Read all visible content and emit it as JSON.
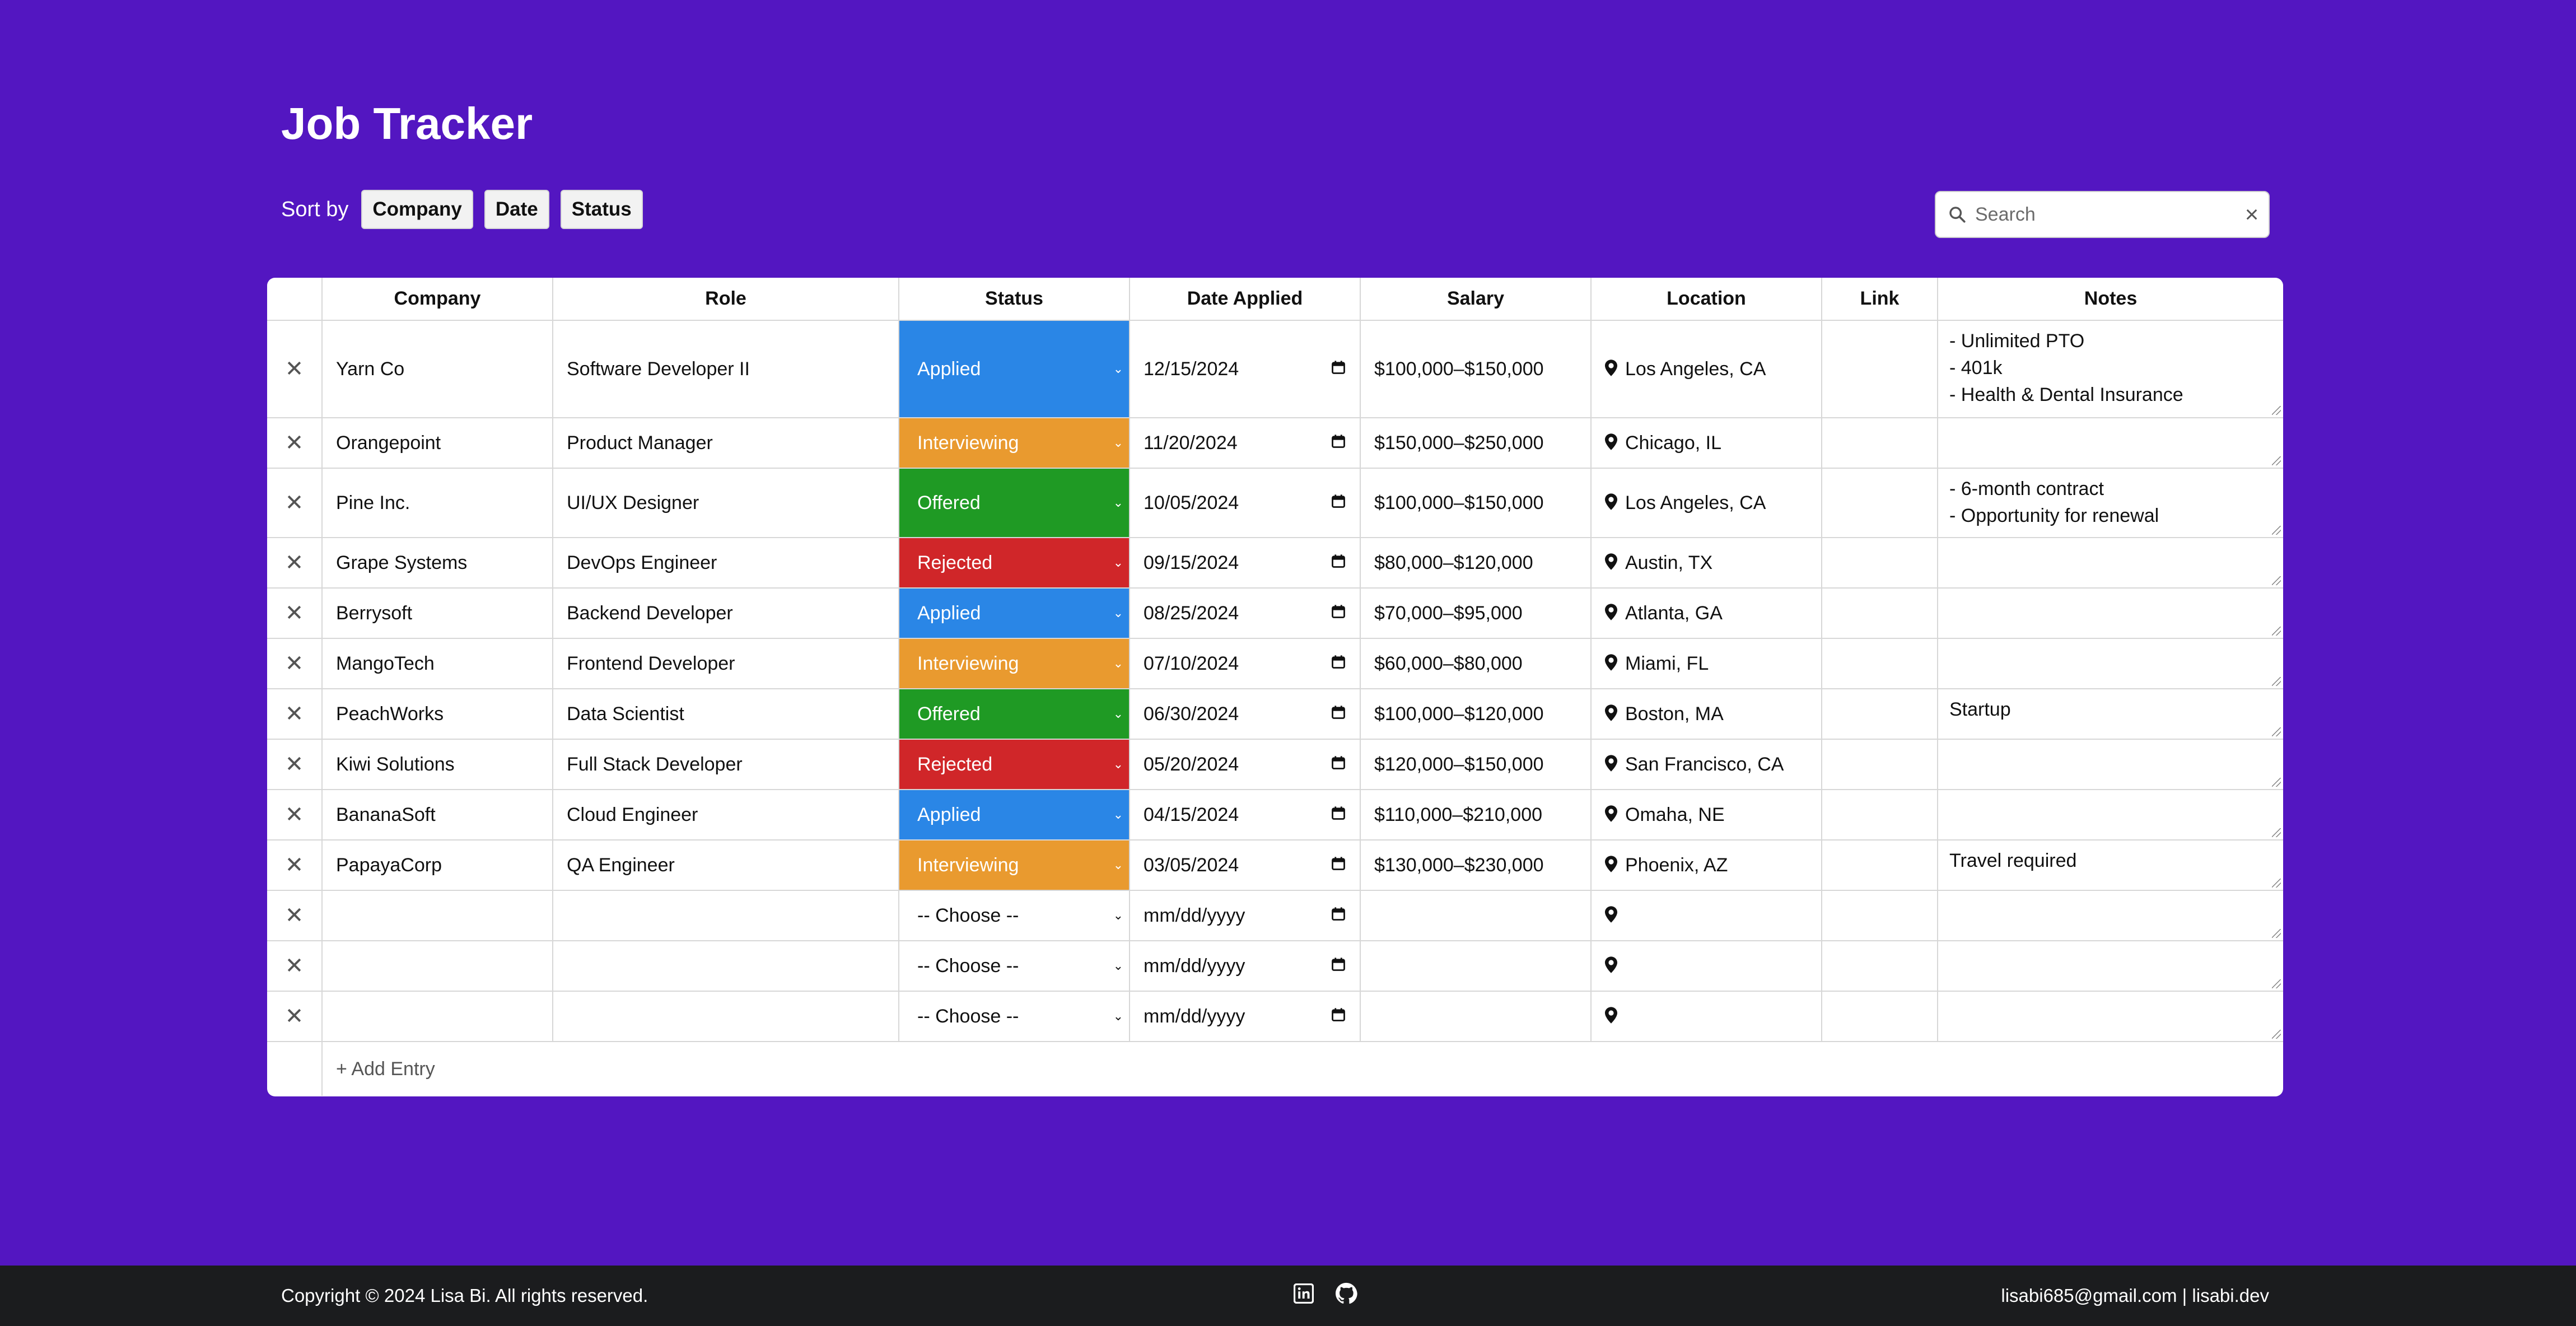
{
  "app": {
    "title": "Job Tracker"
  },
  "sort": {
    "label": "Sort by",
    "buttons": [
      "Company",
      "Date",
      "Status"
    ]
  },
  "search": {
    "placeholder": "Search",
    "value": ""
  },
  "colors": {
    "background": "#5316c1",
    "Applied": "#2a86e6",
    "Interviewing": "#e99a2f",
    "Offered": "#1f9a24",
    "Rejected": "#d02629"
  },
  "table": {
    "headers": [
      "",
      "Company",
      "Role",
      "Status",
      "Date Applied",
      "Salary",
      "Location",
      "Link",
      "Notes"
    ],
    "rows": [
      {
        "company": "Yarn Co",
        "role": "Software Developer II",
        "status": "Applied",
        "date": "12/15/2024",
        "salary": "$100,000–$150,000",
        "location": "Los Angeles, CA",
        "link": "",
        "notes": "- Unlimited PTO\n- 401k\n- Health & Dental Insurance"
      },
      {
        "company": "Orangepoint",
        "role": "Product Manager",
        "status": "Interviewing",
        "date": "11/20/2024",
        "salary": "$150,000–$250,000",
        "location": "Chicago, IL",
        "link": "",
        "notes": ""
      },
      {
        "company": "Pine Inc.",
        "role": "UI/UX Designer",
        "status": "Offered",
        "date": "10/05/2024",
        "salary": "$100,000–$150,000",
        "location": "Los Angeles, CA",
        "link": "",
        "notes": "- 6-month contract\n- Opportunity for renewal"
      },
      {
        "company": "Grape Systems",
        "role": "DevOps Engineer",
        "status": "Rejected",
        "date": "09/15/2024",
        "salary": "$80,000–$120,000",
        "location": "Austin, TX",
        "link": "",
        "notes": ""
      },
      {
        "company": "Berrysoft",
        "role": "Backend Developer",
        "status": "Applied",
        "date": "08/25/2024",
        "salary": "$70,000–$95,000",
        "location": "Atlanta, GA",
        "link": "",
        "notes": ""
      },
      {
        "company": "MangoTech",
        "role": "Frontend Developer",
        "status": "Interviewing",
        "date": "07/10/2024",
        "salary": "$60,000–$80,000",
        "location": "Miami, FL",
        "link": "",
        "notes": ""
      },
      {
        "company": "PeachWorks",
        "role": "Data Scientist",
        "status": "Offered",
        "date": "06/30/2024",
        "salary": "$100,000–$120,000",
        "location": "Boston, MA",
        "link": "",
        "notes": "Startup"
      },
      {
        "company": "Kiwi Solutions",
        "role": "Full Stack Developer",
        "status": "Rejected",
        "date": "05/20/2024",
        "salary": "$120,000–$150,000",
        "location": "San Francisco, CA",
        "link": "",
        "notes": ""
      },
      {
        "company": "BananaSoft",
        "role": "Cloud Engineer",
        "status": "Applied",
        "date": "04/15/2024",
        "salary": "$110,000–$210,000",
        "location": "Omaha, NE",
        "link": "",
        "notes": ""
      },
      {
        "company": "PapayaCorp",
        "role": "QA Engineer",
        "status": "Interviewing",
        "date": "03/05/2024",
        "salary": "$130,000–$230,000",
        "location": "Phoenix, AZ",
        "link": "",
        "notes": "Travel required"
      },
      {
        "company": "",
        "role": "",
        "status": "-- Choose --",
        "date": "mm/dd/yyyy",
        "salary": "",
        "location": "",
        "link": "",
        "notes": ""
      },
      {
        "company": "",
        "role": "",
        "status": "-- Choose --",
        "date": "mm/dd/yyyy",
        "salary": "",
        "location": "",
        "link": "",
        "notes": ""
      },
      {
        "company": "",
        "role": "",
        "status": "-- Choose --",
        "date": "mm/dd/yyyy",
        "salary": "",
        "location": "",
        "link": "",
        "notes": ""
      }
    ],
    "add_label": "+ Add Entry",
    "delete_glyph": "✕"
  },
  "footer": {
    "copyright": "Copyright © 2024 Lisa Bi. All rights reserved.",
    "contact": "lisabi685@gmail.com | lisabi.dev",
    "icons": [
      "linkedin-icon",
      "github-icon"
    ]
  }
}
